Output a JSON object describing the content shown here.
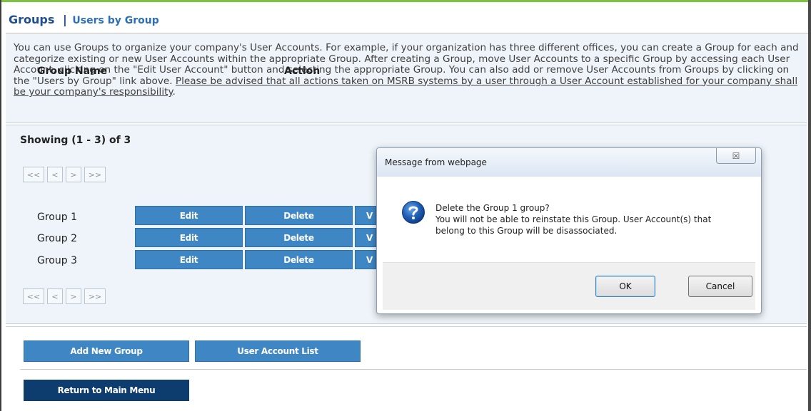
{
  "header": {
    "groups_label": "Groups",
    "separator": "|",
    "users_by_group_label": "Users by Group"
  },
  "intro": {
    "text": "You can use Groups to organize your company's User Accounts. For example, if your organization has three different offices, you can create a Group for each and categorize existing or new User Accounts within the appropriate Group. After creating a Group, move User Accounts to a specific Group by accessing each User Account, clicking on the \"Edit User Account\" button and selecting the appropriate Group. You can also add or remove User Accounts from Groups by clicking on the \"Users by Group\" link above. ",
    "advisory": "Please be advised that all actions taken on MSRB systems by a user through a User Account established for your company shall be your company's responsibility",
    "end": "."
  },
  "listing": {
    "showing": "Showing (1 - 3) of 3",
    "pager": {
      "first": "<<",
      "prev": "<",
      "next": ">",
      "last": ">>"
    },
    "columns": {
      "name": "Group Name",
      "action": "Action"
    },
    "rows": [
      {
        "name": "Group 1",
        "edit": "Edit",
        "delete": "Delete",
        "view": "V"
      },
      {
        "name": "Group 2",
        "edit": "Edit",
        "delete": "Delete",
        "view": "V"
      },
      {
        "name": "Group 3",
        "edit": "Edit",
        "delete": "Delete",
        "view": "V"
      }
    ]
  },
  "actions": {
    "add_group": "Add New Group",
    "user_account_list": "User Account List",
    "return_main": "Return to Main Menu"
  },
  "dialog": {
    "title": "Message from webpage",
    "close_glyph": "☒",
    "line1": "Delete the Group 1 group?",
    "line2": "You will not be able to reinstate this Group.  User Account(s) that",
    "line3": "belong to this Group will be disassociated.",
    "ok": "OK",
    "cancel": "Cancel"
  },
  "colors": {
    "accent_green": "#7dc242",
    "button_blue": "#3f86c5",
    "navy": "#0d3c6e",
    "panel_bg": "#eef4f9"
  }
}
